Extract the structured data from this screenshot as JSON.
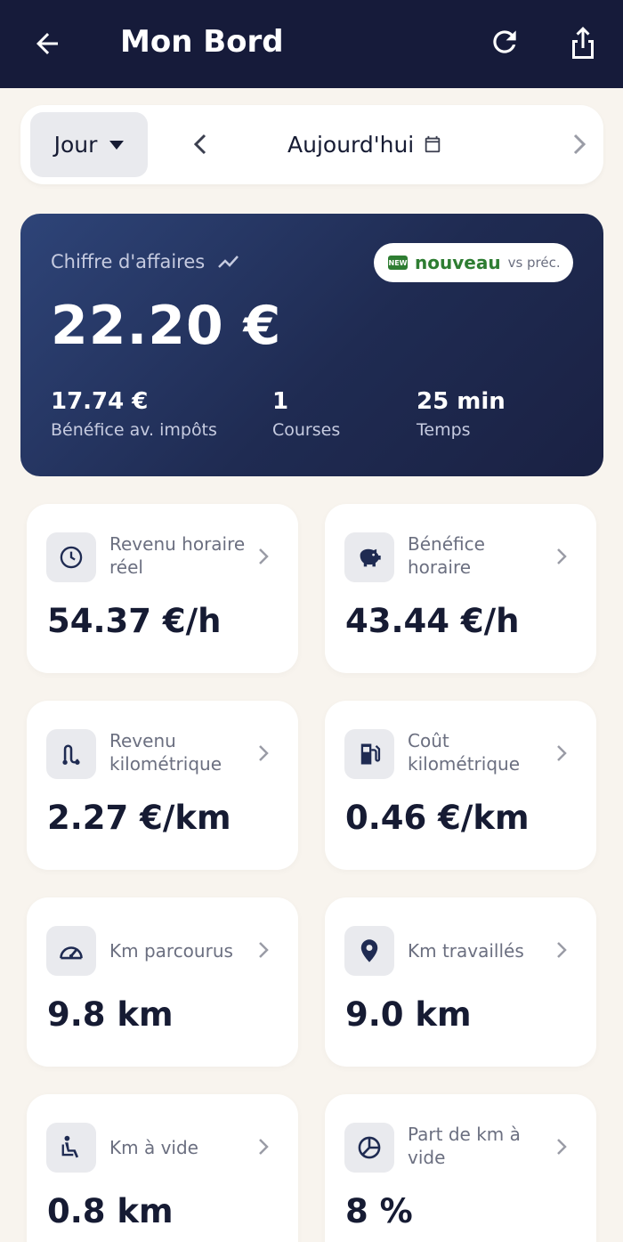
{
  "header": {
    "title": "Mon Bord",
    "icons": [
      "arrow-left-icon",
      "refresh-icon",
      "share-icon"
    ]
  },
  "date_selector": {
    "period": "Jour",
    "date_label": "Aujourd'hui"
  },
  "summary": {
    "label": "Chiffre d'affaires",
    "badge_tag": "NEW",
    "badge_word": "nouveau",
    "badge_suffix": "vs préc.",
    "amount": "22.20 €",
    "stats": [
      {
        "value": "17.74 €",
        "label": "Bénéfice av. impôts"
      },
      {
        "value": "1",
        "label": "Courses"
      },
      {
        "value": "25 min",
        "label": "Temps"
      }
    ]
  },
  "cards": [
    {
      "title": "Revenu horaire réel",
      "value": "54.37 €/h",
      "icon": "clock-icon"
    },
    {
      "title": "Bénéfice horaire",
      "value": "43.44 €/h",
      "icon": "piggy-bank-icon"
    },
    {
      "title": "Revenu kilométrique",
      "value": "2.27 €/km",
      "icon": "route-icon"
    },
    {
      "title": "Coût kilométrique",
      "value": "0.46 €/km",
      "icon": "fuel-pump-icon"
    },
    {
      "title": "Km parcourus",
      "value": "9.8 km",
      "icon": "speedometer-icon"
    },
    {
      "title": "Km travaillés",
      "value": "9.0 km",
      "icon": "location-pin-icon"
    },
    {
      "title": "Km à vide",
      "value": "0.8 km",
      "icon": "seat-icon"
    },
    {
      "title": "Part de km à vide",
      "value": "8 %",
      "icon": "pie-chart-icon"
    }
  ],
  "colors": {
    "header_bg": "#161b3a",
    "page_bg": "#f8f4ee",
    "hero_gradient_start": "#2e4478",
    "hero_gradient_end": "#1a2143",
    "badge_green": "#2e7d32",
    "text_dark": "#161b33",
    "text_muted": "#6b6f80"
  }
}
